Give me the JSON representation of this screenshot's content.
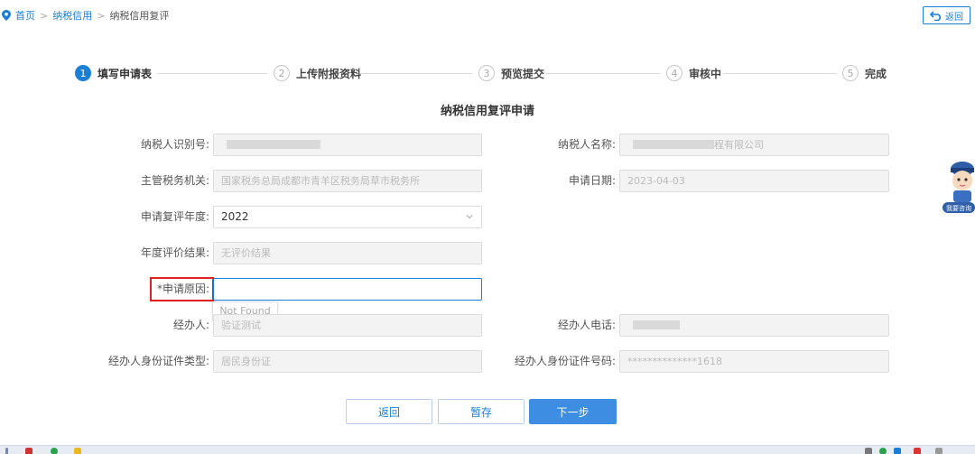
{
  "breadcrumb": {
    "home": "首页",
    "section": "纳税信用",
    "current": "纳税信用复评",
    "separator": ">"
  },
  "back_button": {
    "label": "返回"
  },
  "steps": [
    {
      "num": "1",
      "label": "填写申请表"
    },
    {
      "num": "2",
      "label": "上传附报资料"
    },
    {
      "num": "3",
      "label": "预览提交"
    },
    {
      "num": "4",
      "label": "审核中"
    },
    {
      "num": "5",
      "label": "完成"
    }
  ],
  "form": {
    "title": "纳税信用复评申请",
    "taxpayer_id_label": "纳税人识别号:",
    "taxpayer_name_label": "纳税人名称:",
    "taxpayer_name_value": "程有限公司",
    "tax_authority_label": "主管税务机关:",
    "tax_authority_value": "国家税务总局成都市青羊区税务局草市税务所",
    "apply_date_label": "申请日期:",
    "apply_date_value": "2023-04-03",
    "review_year_label": "申请复评年度:",
    "review_year_value": "2022",
    "annual_result_label": "年度评价结果:",
    "annual_result_value": "无评价结果",
    "reason_label": "*申请原因:",
    "reason_value": "",
    "tooltip": "Not Found",
    "handler_label": "经办人:",
    "handler_value": "验证测试",
    "handler_phone_label": "经办人电话:",
    "id_type_label": "经办人身份证件类型:",
    "id_type_value": "居民身份证",
    "id_number_label": "经办人身份证件号码:",
    "id_number_value": "**************1618"
  },
  "buttons": {
    "back": "返回",
    "save": "暂存",
    "next": "下一步"
  },
  "mascot": {
    "caption": "我要咨询"
  },
  "colors": {
    "accent": "#1a7fd6",
    "primary_button": "#3d8de3",
    "required_outline": "#e02020"
  }
}
